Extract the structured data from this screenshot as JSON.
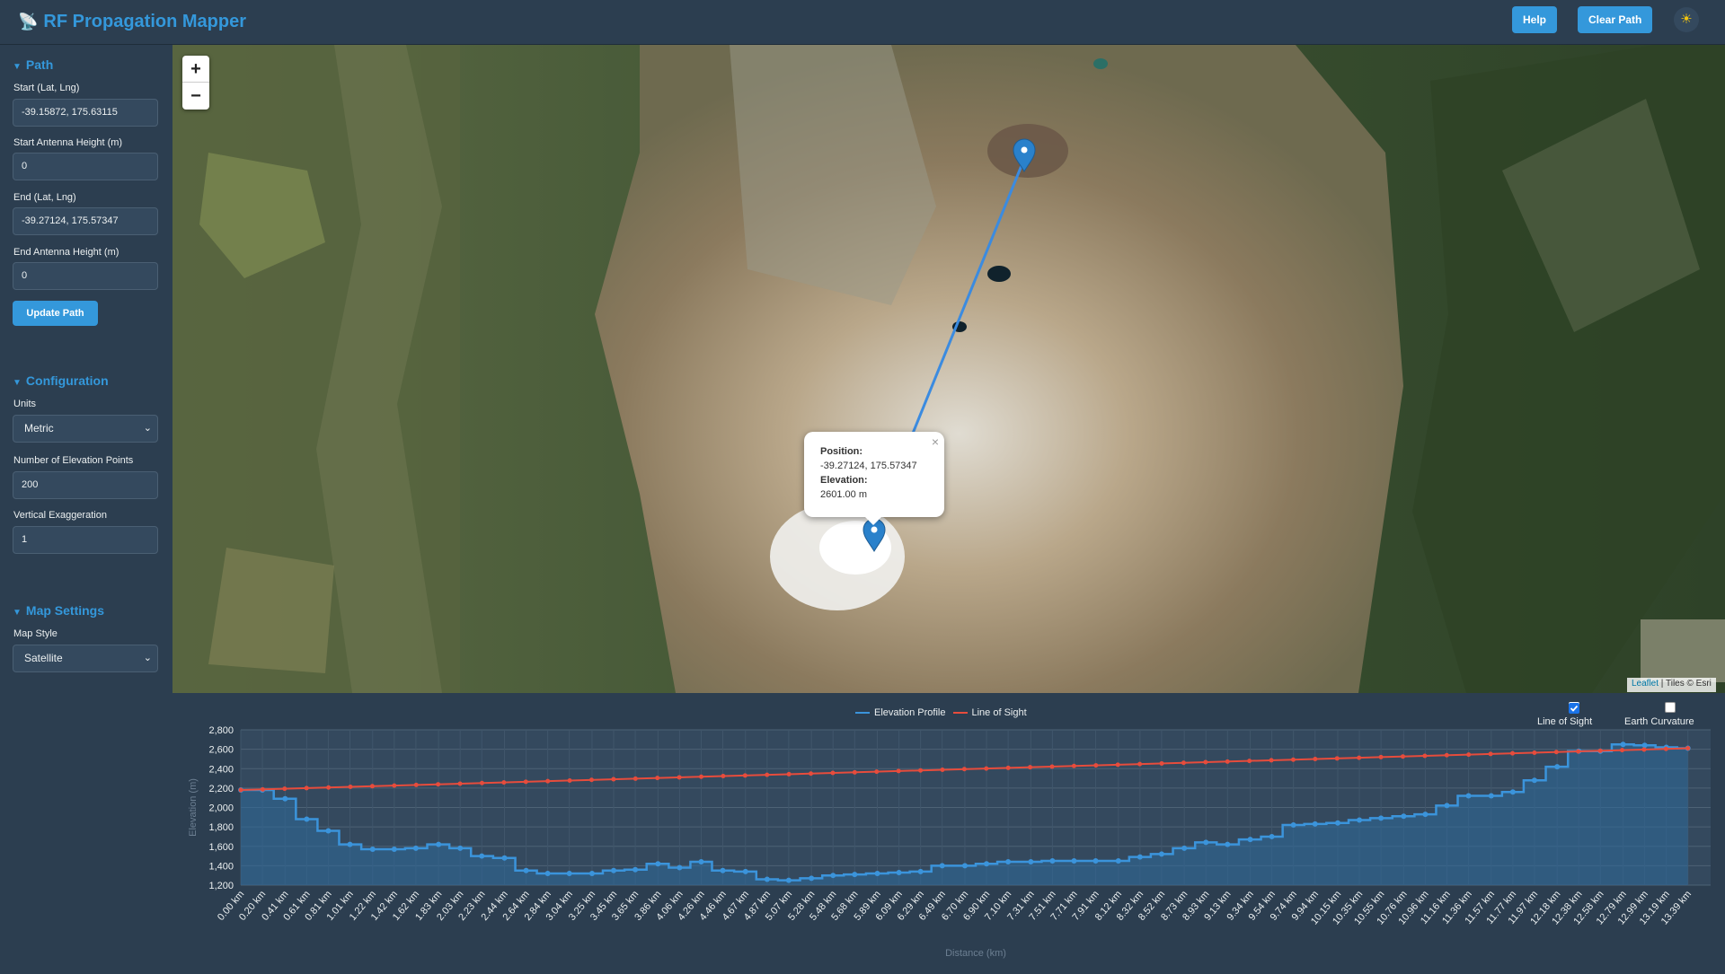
{
  "header": {
    "app_title": "RF Propagation Mapper",
    "logo_icon": "satellite-dish-icon",
    "help_label": "Help",
    "clear_label": "Clear Path",
    "theme_icon": "sun-icon"
  },
  "sidebar": {
    "path": {
      "title": "Path",
      "start_label": "Start (Lat, Lng)",
      "start_value": "-39.15872, 175.63115",
      "start_height_label": "Start Antenna Height (m)",
      "start_height_value": "0",
      "end_label": "End (Lat, Lng)",
      "end_value": "-39.27124, 175.57347",
      "end_height_label": "End Antenna Height (m)",
      "end_height_value": "0",
      "update_label": "Update Path"
    },
    "config": {
      "title": "Configuration",
      "units_label": "Units",
      "units_value": "Metric",
      "points_label": "Number of Elevation Points",
      "points_value": "200",
      "exag_label": "Vertical Exaggeration",
      "exag_value": "1"
    },
    "map_settings": {
      "title": "Map Settings",
      "style_label": "Map Style",
      "style_value": "Satellite"
    }
  },
  "map": {
    "zoom_in": "+",
    "zoom_out": "−",
    "popup": {
      "position_label": "Position:",
      "position_value": "-39.27124, 175.57347",
      "elevation_label": "Elevation:",
      "elevation_value": "2601.00 m",
      "close": "×"
    },
    "attribution_link": "Leaflet",
    "attribution_rest": " | Tiles © Esri",
    "colors": {
      "path_line": "#3b8be0",
      "marker": "#2a81cb"
    }
  },
  "chart_options": {
    "line_of_sight_label": "Line of Sight",
    "line_of_sight_checked": true,
    "earth_curvature_label": "Earth Curvature",
    "earth_curvature_checked": false
  },
  "chart_data": {
    "type": "line",
    "xlabel": "Distance (km)",
    "ylabel": "Elevation (m)",
    "ylim": [
      1200,
      2800
    ],
    "yticks": [
      "1,200",
      "1,400",
      "1,600",
      "1,800",
      "2,000",
      "2,200",
      "2,400",
      "2,600",
      "2,800"
    ],
    "grid": true,
    "legend_position": "top",
    "x_tick_labels": [
      "0.00 km",
      "0.20 km",
      "0.41 km",
      "0.61 km",
      "0.81 km",
      "1.01 km",
      "1.22 km",
      "1.42 km",
      "1.62 km",
      "1.83 km",
      "2.03 km",
      "2.23 km",
      "2.44 km",
      "2.64 km",
      "2.84 km",
      "3.04 km",
      "3.25 km",
      "3.45 km",
      "3.65 km",
      "3.86 km",
      "4.06 km",
      "4.26 km",
      "4.46 km",
      "4.67 km",
      "4.87 km",
      "5.07 km",
      "5.28 km",
      "5.48 km",
      "5.68 km",
      "5.89 km",
      "6.09 km",
      "6.29 km",
      "6.49 km",
      "6.70 km",
      "6.90 km",
      "7.10 km",
      "7.31 km",
      "7.51 km",
      "7.71 km",
      "7.91 km",
      "8.12 km",
      "8.32 km",
      "8.52 km",
      "8.73 km",
      "8.93 km",
      "9.13 km",
      "9.34 km",
      "9.54 km",
      "9.74 km",
      "9.94 km",
      "10.15 km",
      "10.35 km",
      "10.55 km",
      "10.76 km",
      "10.96 km",
      "11.16 km",
      "11.36 km",
      "11.57 km",
      "11.77 km",
      "11.97 km",
      "12.18 km",
      "12.38 km",
      "12.58 km",
      "12.79 km",
      "12.99 km",
      "13.19 km",
      "13.39 km"
    ],
    "series": [
      {
        "name": "Elevation Profile",
        "color": "#3b94db",
        "x_km": [
          0.0,
          0.2,
          0.41,
          0.61,
          0.81,
          1.01,
          1.22,
          1.42,
          1.62,
          1.83,
          2.03,
          2.23,
          2.44,
          2.64,
          2.84,
          3.04,
          3.25,
          3.45,
          3.65,
          3.86,
          4.06,
          4.26,
          4.46,
          4.67,
          4.87,
          5.07,
          5.28,
          5.48,
          5.68,
          5.89,
          6.09,
          6.29,
          6.49,
          6.7,
          6.9,
          7.1,
          7.31,
          7.51,
          7.71,
          7.91,
          8.12,
          8.32,
          8.52,
          8.73,
          8.93,
          9.13,
          9.34,
          9.54,
          9.74,
          9.94,
          10.15,
          10.35,
          10.55,
          10.76,
          10.96,
          11.16,
          11.36,
          11.57,
          11.77,
          11.97,
          12.18,
          12.38,
          12.58,
          12.79,
          12.99,
          13.19,
          13.39
        ],
        "values": [
          2180,
          2180,
          2090,
          1880,
          1760,
          1620,
          1570,
          1570,
          1580,
          1620,
          1580,
          1500,
          1480,
          1350,
          1320,
          1320,
          1320,
          1350,
          1360,
          1420,
          1380,
          1440,
          1350,
          1340,
          1260,
          1250,
          1270,
          1300,
          1310,
          1320,
          1330,
          1340,
          1400,
          1400,
          1420,
          1440,
          1440,
          1450,
          1450,
          1450,
          1450,
          1490,
          1520,
          1580,
          1640,
          1620,
          1670,
          1700,
          1820,
          1830,
          1840,
          1870,
          1890,
          1910,
          1930,
          2020,
          2120,
          2120,
          2160,
          2280,
          2420,
          2580,
          2580,
          2650,
          2640,
          2620,
          2610
        ]
      },
      {
        "name": "Line of Sight",
        "color": "#e74c3c",
        "x_km": [
          0.0,
          13.39
        ],
        "values": [
          2180,
          2610
        ]
      }
    ]
  }
}
